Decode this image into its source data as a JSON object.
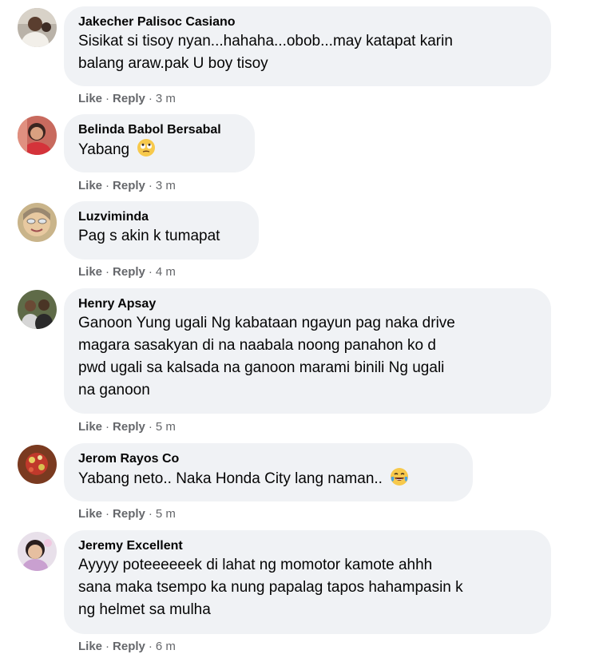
{
  "comments": [
    {
      "author": "Jakecher Palisoc Casiano",
      "lines": [
        "Sisikat si tisoy nyan...hahaha...obob...may katapat karin",
        "balang araw.pak U boy tisoy"
      ],
      "like": "Like",
      "reply": "Reply",
      "time": "3 m",
      "avatar_icon": "profile-photo"
    },
    {
      "author": "Belinda Babol Bersabal",
      "lines": [
        "Yabang"
      ],
      "emoji": "face-with-rolling-eyes",
      "like": "Like",
      "reply": "Reply",
      "time": "3 m",
      "avatar_icon": "profile-photo"
    },
    {
      "author": "Luzviminda",
      "lines": [
        "Pag s akin k tumapat"
      ],
      "like": "Like",
      "reply": "Reply",
      "time": "4 m",
      "avatar_icon": "profile-photo"
    },
    {
      "author": "Henry Apsay",
      "lines": [
        "Ganoon Yung ugali Ng kabataan ngayun pag naka drive",
        "magara sasakyan di na naabala noong panahon ko d",
        "pwd ugali sa kalsada na ganoon marami binili Ng ugali",
        "na ganoon"
      ],
      "like": "Like",
      "reply": "Reply",
      "time": "5 m",
      "avatar_icon": "profile-photo"
    },
    {
      "author": "Jerom Rayos Co",
      "lines": [
        "Yabang neto.. Naka Honda City lang naman.."
      ],
      "emoji": "face-with-tears-of-joy",
      "like": "Like",
      "reply": "Reply",
      "time": "5 m",
      "avatar_icon": "profile-photo"
    },
    {
      "author": "Jeremy Excellent",
      "lines": [
        "Ayyyy poteeeeeek di lahat ng momotor kamote ahhh",
        "sana maka tsempo ka nung papalag tapos hahampasin k",
        "ng helmet sa mulha"
      ],
      "like": "Like",
      "reply": "Reply",
      "time": "6 m",
      "avatar_icon": "profile-photo"
    }
  ],
  "colors": {
    "bubble": "#f0f2f5",
    "secondary_text": "#65676b",
    "primary_text": "#050505"
  }
}
